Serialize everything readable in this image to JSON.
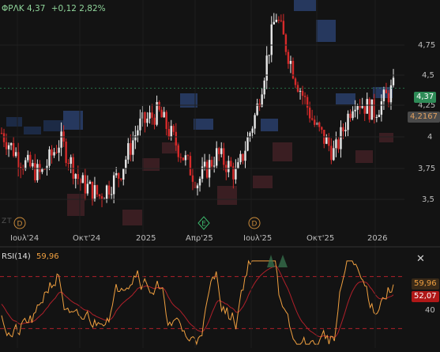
{
  "header": {
    "symbol": "ΦΡΛΚ",
    "price": "4,37",
    "change": "+0,12 2,82%"
  },
  "price_axis": {
    "ticks": [
      "4,75",
      "4,5",
      "4,25",
      "4",
      "3,75",
      "3,5"
    ]
  },
  "price_tags": {
    "last": "4,37",
    "last_color": "#2e8b57",
    "ref": "4,2167",
    "ref_color": "#4a4a4a"
  },
  "time_axis": {
    "ticks": [
      "Ιουλ'24",
      "Οκτ'24",
      "2025",
      "Απρ'25",
      "Ιουλ'25",
      "Οκτ'25",
      "2026"
    ]
  },
  "event_markers": [
    {
      "label": "D",
      "color": "#c98a3a"
    },
    {
      "label": "E",
      "color": "#3bb36a"
    },
    {
      "label": "D",
      "color": "#c98a3a"
    }
  ],
  "watermark": "ZT",
  "rsi": {
    "title": "RSI(14)",
    "value": "59,96",
    "value_color": "#f0a040",
    "ma_value": "52,07",
    "ma_color": "#d02020",
    "axis_ticks": [
      "40"
    ],
    "close_icon": "close-icon"
  },
  "colors": {
    "up": "#e8e8e8",
    "down": "#d62a2a",
    "rsi": "#f0a040",
    "rsi_ma": "#b0202a",
    "bg": "#131313"
  },
  "chart_data": {
    "type": "candlestick",
    "ylim": [
      3.35,
      5.0
    ],
    "series_anchor_closes": [
      [
        "2024-06",
        4.05
      ],
      [
        "2024-07",
        3.85
      ],
      [
        "2024-08",
        3.75
      ],
      [
        "2024-09",
        4.0
      ],
      [
        "2024-10",
        3.7
      ],
      [
        "2024-11",
        3.6
      ],
      [
        "2024-12",
        3.75
      ],
      [
        "2025-01",
        4.1
      ],
      [
        "2025-02",
        4.2
      ],
      [
        "2025-03",
        3.95
      ],
      [
        "2025-04",
        3.7
      ],
      [
        "2025-05",
        3.9
      ],
      [
        "2025-06",
        3.75
      ],
      [
        "2025-07",
        4.2
      ],
      [
        "2025-08",
        4.9
      ],
      [
        "2025-09",
        4.45
      ],
      [
        "2025-10",
        4.1
      ],
      [
        "2025-11",
        3.9
      ],
      [
        "2025-12",
        4.3
      ],
      [
        "2026-01",
        4.2
      ],
      [
        "2026-02",
        4.37
      ]
    ],
    "rsi_levels": {
      "upper": 70,
      "lower": 30
    }
  }
}
